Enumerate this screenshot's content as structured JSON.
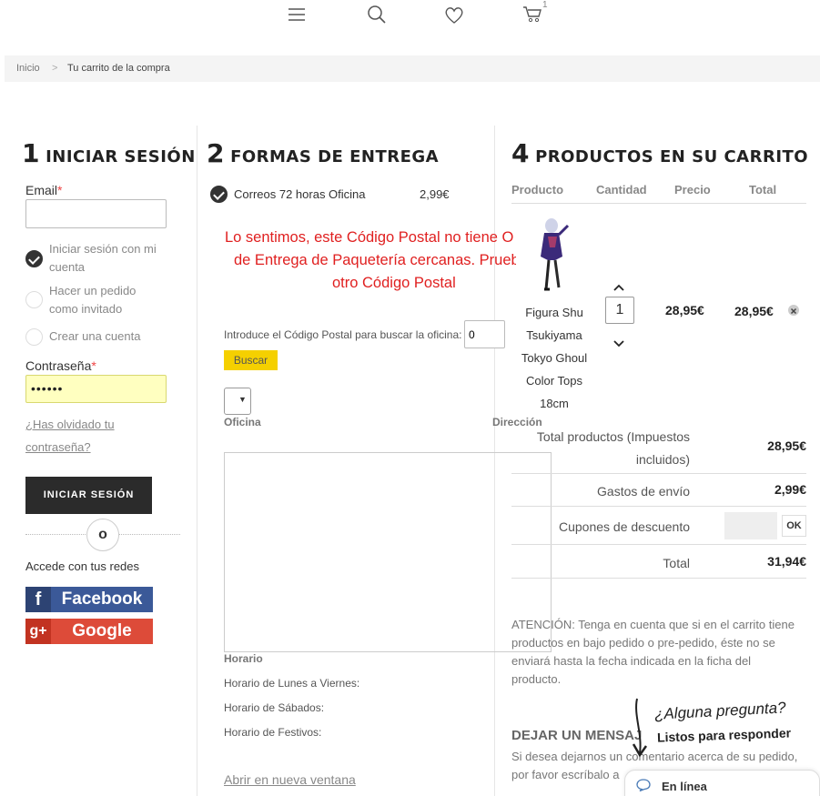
{
  "header": {
    "cart_count": "1"
  },
  "breadcrumb": {
    "home": "Inicio",
    "sep": ">",
    "current": "Tu carrito de la compra"
  },
  "login": {
    "step_num": "1",
    "step_title": "INICIAR SESIÓN",
    "email_label": "Email",
    "email_req": "*",
    "email_value": "",
    "options": [
      "Iniciar sesión con mi cuenta",
      "Hacer un pedido como invitado",
      "Crear una cuenta"
    ],
    "option_lines": [
      [
        "Iniciar sesión con mi",
        "cuenta"
      ],
      [
        "Hacer un pedido",
        "como invitado"
      ],
      [
        "Crear una cuenta"
      ]
    ],
    "password_label": "Contraseña",
    "password_req": "*",
    "password_value": "••••••",
    "forgot_line1": "¿Has olvidado tu",
    "forgot_line2": "contraseña?",
    "submit": "INICIAR SESIÓN",
    "or": "o",
    "social_label": "Accede con tus redes",
    "facebook": "Facebook",
    "google": "Google"
  },
  "delivery": {
    "step_num": "2",
    "step_title": "FORMAS DE ENTREGA",
    "method": "Correos 72 horas Oficina",
    "method_price": "2,99€",
    "error_lines": [
      "Lo sentimos, este Código Postal no tiene O",
      "de Entrega de Paquetería cercanas. Prueb",
      "otro Código Postal"
    ],
    "postal_label": "Introduce el Código Postal para buscar la oficina:",
    "postal_value": "0",
    "search_button": "Buscar",
    "col_office": "Oficina",
    "col_address": "Dirección",
    "schedule_title": "Horario",
    "schedule_weekdays": "Horario de Lunes a Viernes:",
    "schedule_saturday": "Horario de Sábados:",
    "schedule_holidays": "Horario de Festivos:",
    "open_new_window": "Abrir en nueva ventana"
  },
  "cart": {
    "step_num": "4",
    "step_title": "PRODUCTOS EN SU CARRITO",
    "headers": [
      "Producto",
      "Cantidad",
      "Precio",
      "Total"
    ],
    "item": {
      "name_lines": [
        "Figura Shu",
        "Tsukiyama",
        "Tokyo Ghoul",
        "Color Tops",
        "18cm"
      ],
      "quantity": "1",
      "price": "28,95€",
      "total": "28,95€"
    },
    "summary": {
      "products_label_1": "Total productos (Impuestos",
      "products_label_2": "incluidos)",
      "products_value": "28,95€",
      "shipping_label": "Gastos de envío",
      "shipping_value": "2,99€",
      "coupon_label": "Cupones de descuento",
      "coupon_button": "OK",
      "total_label": "Total",
      "total_value": "31,94€"
    },
    "notice": [
      "ATENCIÓN: Tenga en cuenta que si en el carrito tiene",
      "productos en bajo pedido o pre-pedido, éste no se",
      "enviará hasta la fecha indicada en la ficha del",
      "producto."
    ],
    "message_title": "DEJAR UN MENSAJ",
    "message_text": [
      "Si desea dejarnos un comentario acerca de su pedido,",
      "por favor escríbalo a"
    ]
  },
  "chat": {
    "question": "¿Alguna pregunta?",
    "ready": "Listos para responder",
    "status": "En línea"
  },
  "colors": {
    "accent_yellow": "#f5d000",
    "error_red": "#e02020",
    "facebook": "#3b5998",
    "google": "#dd4b39",
    "dark": "#2b2b2b"
  }
}
